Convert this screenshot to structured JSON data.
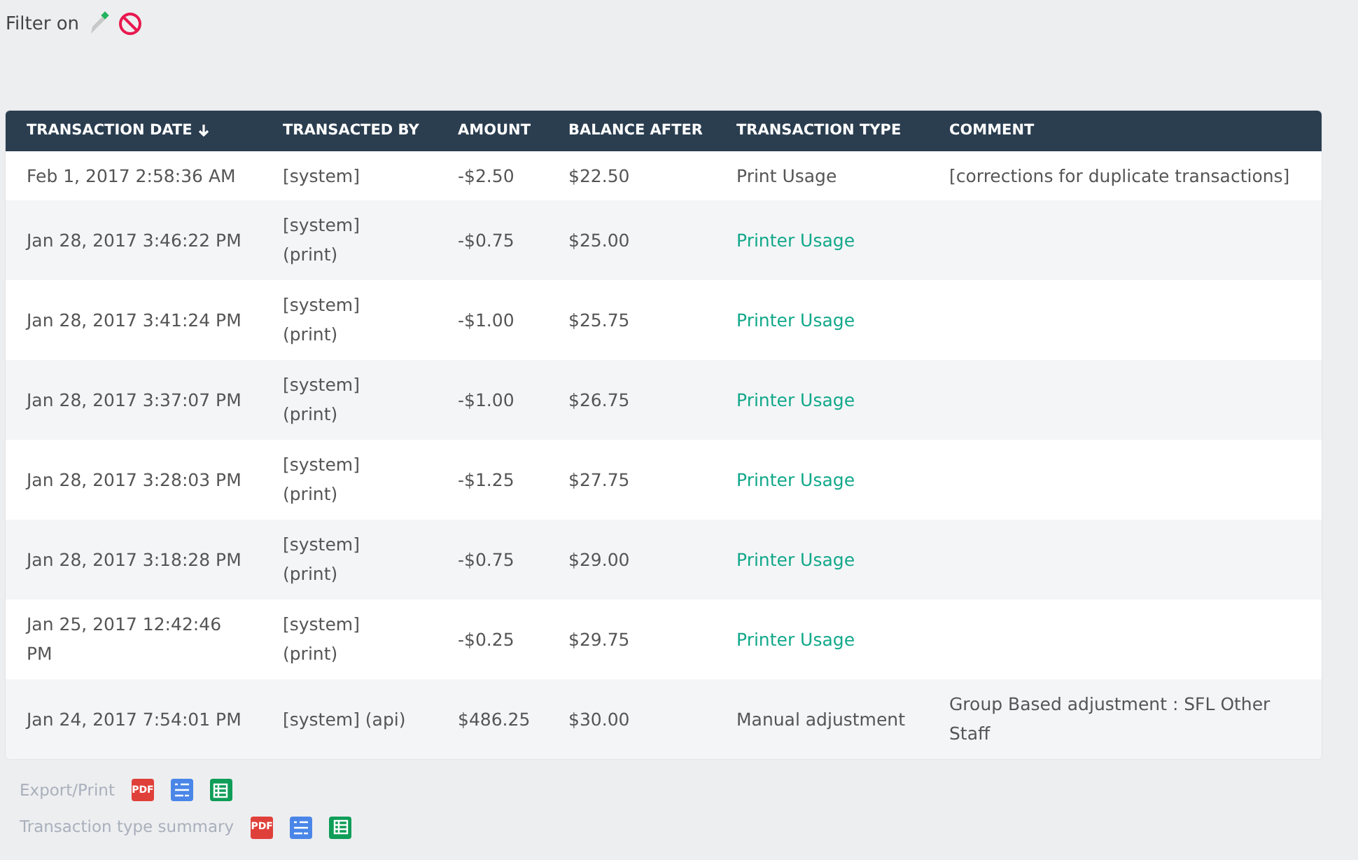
{
  "filter": {
    "label": "Filter on"
  },
  "table": {
    "columns": [
      {
        "label": "TRANSACTION DATE",
        "sorted": true
      },
      {
        "label": "TRANSACTED BY",
        "sorted": false
      },
      {
        "label": "AMOUNT",
        "sorted": false
      },
      {
        "label": "BALANCE AFTER",
        "sorted": false
      },
      {
        "label": "TRANSACTION TYPE",
        "sorted": false
      },
      {
        "label": "COMMENT",
        "sorted": false
      }
    ],
    "rows": [
      {
        "date": "Feb 1, 2017 2:58:36 AM",
        "by": "[system]",
        "amount": "-$2.50",
        "balance": "$22.50",
        "type": {
          "text": "Print Usage",
          "kind": "text"
        },
        "comment": "[corrections for duplicate transactions]"
      },
      {
        "date": "Jan 28, 2017 3:46:22 PM",
        "by": "[system] (print)",
        "amount": "-$0.75",
        "balance": "$25.00",
        "type": {
          "text": "Printer Usage",
          "kind": "link"
        },
        "comment": ""
      },
      {
        "date": "Jan 28, 2017 3:41:24 PM",
        "by": "[system] (print)",
        "amount": "-$1.00",
        "balance": "$25.75",
        "type": {
          "text": "Printer Usage",
          "kind": "link"
        },
        "comment": ""
      },
      {
        "date": "Jan 28, 2017 3:37:07 PM",
        "by": "[system] (print)",
        "amount": "-$1.00",
        "balance": "$26.75",
        "type": {
          "text": "Printer Usage",
          "kind": "link"
        },
        "comment": ""
      },
      {
        "date": "Jan 28, 2017 3:28:03 PM",
        "by": "[system] (print)",
        "amount": "-$1.25",
        "balance": "$27.75",
        "type": {
          "text": "Printer Usage",
          "kind": "link"
        },
        "comment": ""
      },
      {
        "date": "Jan 28, 2017 3:18:28 PM",
        "by": "[system] (print)",
        "amount": "-$0.75",
        "balance": "$29.00",
        "type": {
          "text": "Printer Usage",
          "kind": "link"
        },
        "comment": ""
      },
      {
        "date": "Jan 25, 2017 12:42:46 PM",
        "by": "[system] (print)",
        "amount": "-$0.25",
        "balance": "$29.75",
        "type": {
          "text": "Printer Usage",
          "kind": "link"
        },
        "comment": ""
      },
      {
        "date": "Jan 24, 2017 7:54:01 PM",
        "by": "[system] (api)",
        "amount": "$486.25",
        "balance": "$30.00",
        "type": {
          "text": "Manual adjustment",
          "kind": "text"
        },
        "comment": "Group Based adjustment : SFL Other Staff"
      }
    ]
  },
  "exports": [
    {
      "label": "Export/Print",
      "formats": [
        {
          "kind": "pdf",
          "text": "PDF"
        },
        {
          "kind": "list"
        },
        {
          "kind": "sheet"
        }
      ]
    },
    {
      "label": "Transaction type summary",
      "formats": [
        {
          "kind": "pdf",
          "text": "PDF"
        },
        {
          "kind": "list"
        },
        {
          "kind": "sheet"
        }
      ]
    }
  ]
}
